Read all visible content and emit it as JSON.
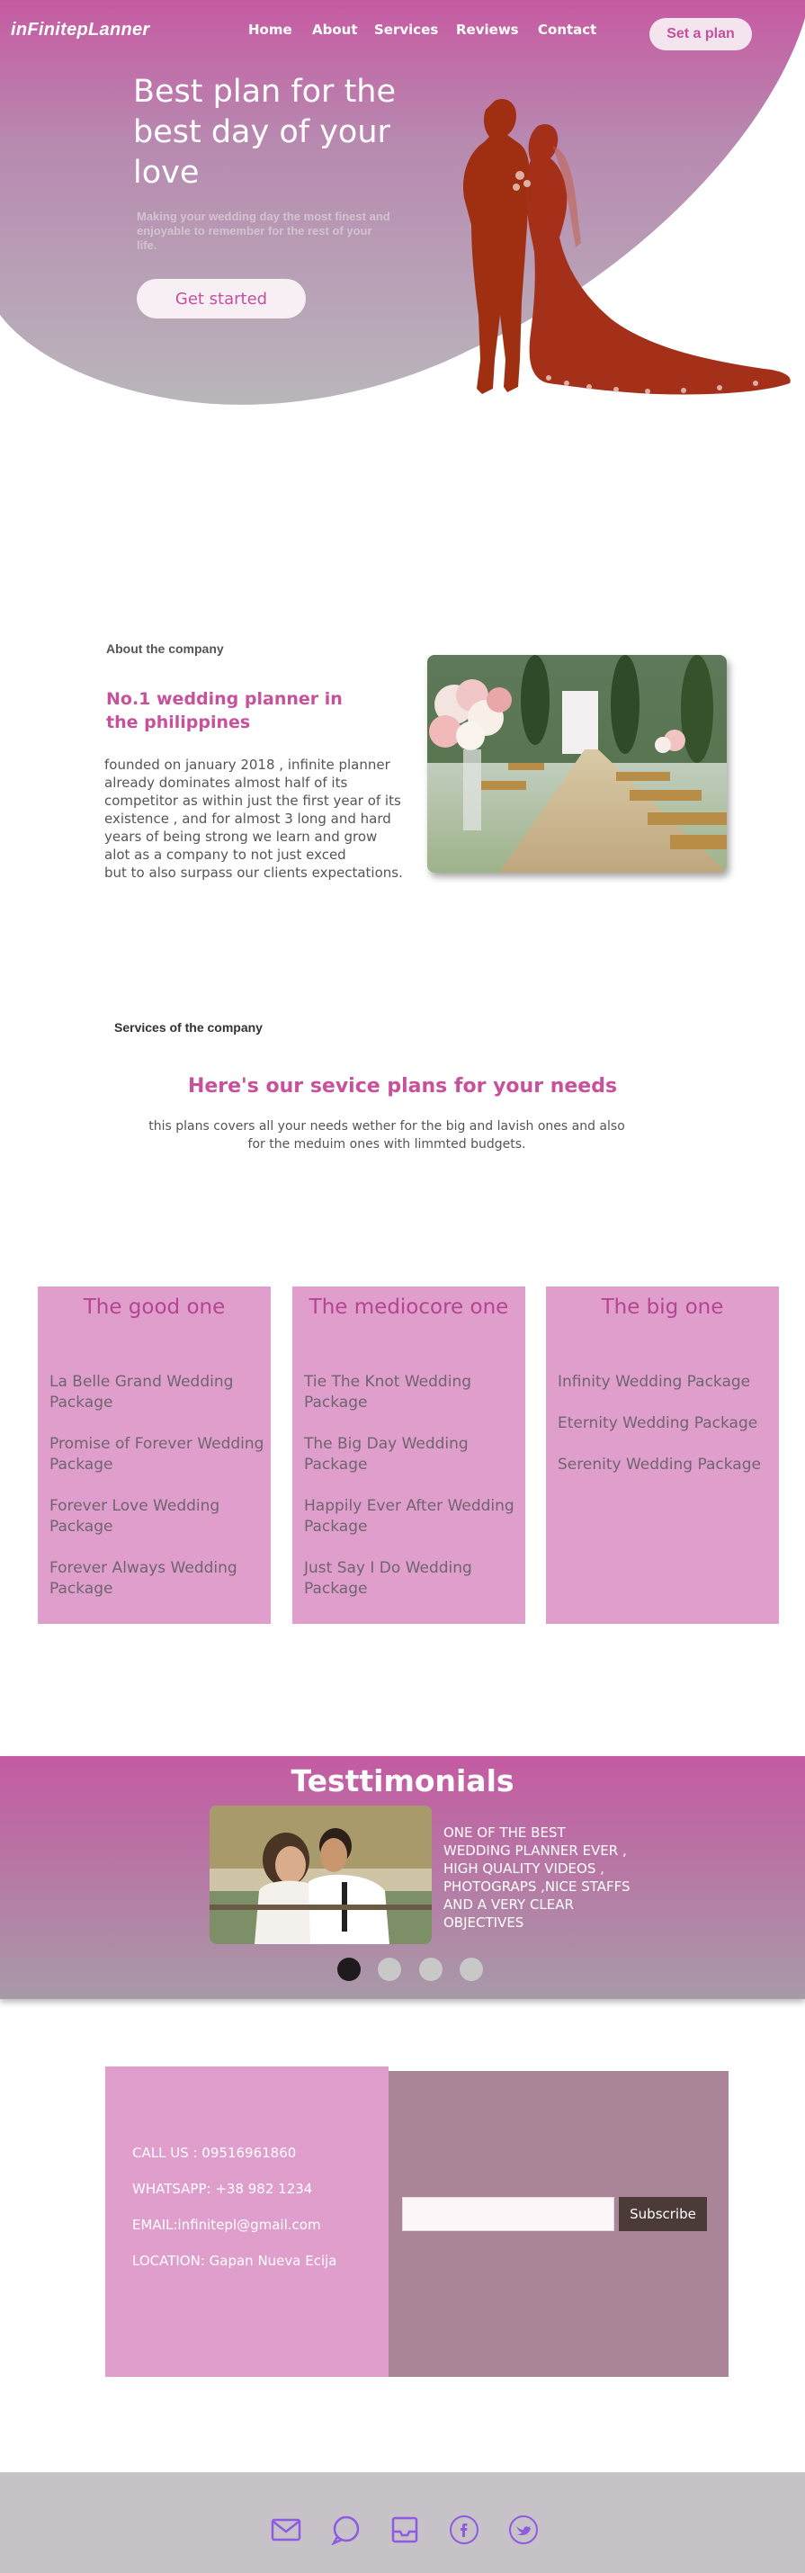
{
  "nav": {
    "logo": "inFinitepLanner",
    "links": [
      "Home",
      "About",
      "Services",
      "Reviews",
      "Contact"
    ],
    "cta": "Set a plan"
  },
  "hero": {
    "title": "Best plan for the best day of your love",
    "subtitle": "Making your wedding day the most finest and enjoyable to remember for the rest of your life.",
    "cta": "Get started"
  },
  "about": {
    "label": "About the company",
    "heading": "No.1 wedding planner in the philippines",
    "text": "founded on january 2018 , infinite planner\nalready dominates almost half of its\ncompetitor as within just the first year of its\nexistence , and for almost 3 long and hard\nyears of being strong we learn and grow\nalot as a company to not just exced\nbut to also surpass our clients expectations."
  },
  "services": {
    "label": "Services of the company",
    "heading": "Here's our sevice plans for your needs",
    "description": "this plans covers all your needs wether for the big and lavish ones  and also for the meduim ones with limmted budgets.",
    "plans": [
      {
        "title": "The good one",
        "items": [
          "La Belle Grand Wedding Package",
          "Promise of Forever Wedding Package",
          "Forever Love Wedding Package",
          "Forever Always Wedding Package"
        ]
      },
      {
        "title": "The mediocore one",
        "items": [
          "Tie The Knot Wedding Package",
          "The Big Day Wedding Package",
          "Happily Ever After Wedding Package",
          "Just Say I Do Wedding Package"
        ]
      },
      {
        "title": "The big one",
        "items": [
          "Infinity Wedding Package",
          "Eternity Wedding Package",
          "Serenity Wedding Package"
        ]
      }
    ]
  },
  "testimonials": {
    "title": "Testtimonials",
    "quote": "ONE OF THE BEST WEDDING PLANNER EVER , HIGH QUALITY VIDEOS , PHOTOGRAPS ,NICE STAFFS AND A VERY CLEAR OBJECTIVES",
    "active_slide": 1,
    "slide_count": 4
  },
  "contact": {
    "call": "CALL US : 09516961860",
    "whatsapp": "WHATSAPP: +38 982 1234",
    "email": "EMAIL:infinitepl@gmail.com",
    "location": "LOCATION: Gapan Nueva Ecija",
    "email_placeholder": "",
    "subscribe": "Subscribe"
  },
  "footer": {
    "icons": [
      "mail-icon",
      "chat-icon",
      "inbox-icon",
      "facebook-icon",
      "twitter-icon"
    ],
    "icon_color": "#8f5be0"
  },
  "colors": {
    "brand_pink": "#c8519b",
    "card_pink": "#df9ecb",
    "mauve": "#a98597"
  }
}
